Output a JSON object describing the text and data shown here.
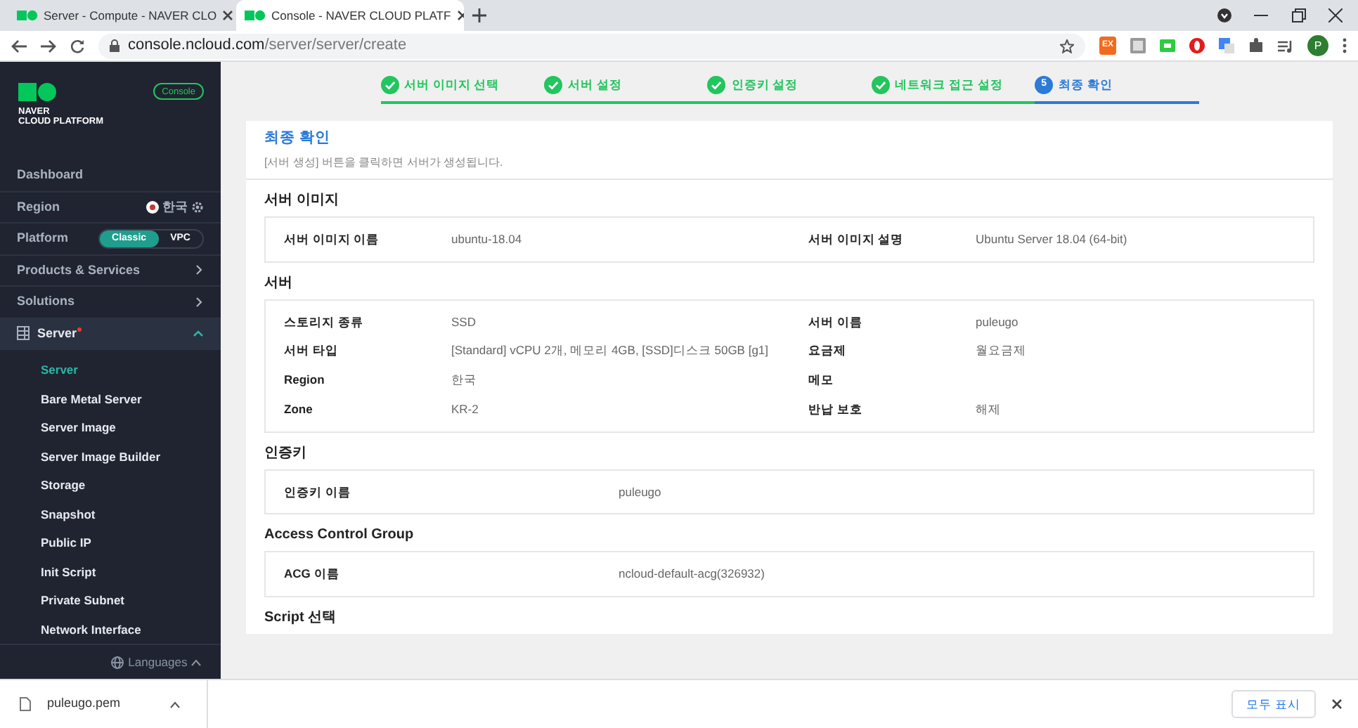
{
  "browser": {
    "tabs": [
      {
        "title": "Server - Compute - NAVER CLO",
        "selected": false
      },
      {
        "title": "Console - NAVER CLOUD PLATF",
        "selected": true
      }
    ],
    "url_host": "console.ncloud.com",
    "url_path": "/server/server/create",
    "extension_label": "EX",
    "profile_initial": "P"
  },
  "sidebar": {
    "logo_line1": "NAVER",
    "logo_line2": "CLOUD PLATFORM",
    "console_badge": "Console",
    "items": [
      {
        "kind": "link",
        "label": "Dashboard"
      },
      {
        "kind": "region",
        "label": "Region",
        "value": "한국"
      },
      {
        "kind": "toggle",
        "label": "Platform",
        "options": [
          {
            "label": "Classic",
            "selected": true
          },
          {
            "label": "VPC",
            "selected": false
          }
        ]
      },
      {
        "kind": "menu",
        "label": "Products & Services"
      },
      {
        "kind": "menu",
        "label": "Solutions"
      },
      {
        "kind": "group",
        "label": "Server",
        "expanded": true,
        "notice": true,
        "children": [
          {
            "label": "Server",
            "selected": true
          },
          {
            "label": "Bare Metal Server",
            "selected": false
          },
          {
            "label": "Server Image",
            "selected": false
          },
          {
            "label": "Server Image Builder",
            "selected": false
          },
          {
            "label": "Storage",
            "selected": false
          },
          {
            "label": "Snapshot",
            "selected": false
          },
          {
            "label": "Public IP",
            "selected": false
          },
          {
            "label": "Init Script",
            "selected": false
          },
          {
            "label": "Private Subnet",
            "selected": false
          },
          {
            "label": "Network Interface",
            "selected": false
          }
        ]
      }
    ],
    "languages": "Languages"
  },
  "steps": [
    {
      "label": "서버 이미지 선택",
      "done": true
    },
    {
      "label": "서버 설정",
      "done": true
    },
    {
      "label": "인증키 설정",
      "done": true
    },
    {
      "label": "네트워크 접근 설정",
      "done": true
    },
    {
      "label": "최종 확인",
      "done": false,
      "number": "5"
    }
  ],
  "card": {
    "title": "최종 확인",
    "subtitle": "[서버 생성] 버튼을 클릭하면 서버가 생성됩니다.",
    "sections": [
      {
        "title": "서버 이미지",
        "kind": "pairs",
        "fields": [
          {
            "label": "서버 이미지 이름",
            "value": "ubuntu-18.04"
          },
          {
            "label": "서버 이미지 설명",
            "value": "Ubuntu Server 18.04 (64-bit)"
          }
        ]
      },
      {
        "title": "서버",
        "kind": "pairs",
        "fields": [
          {
            "label": "스토리지 종류",
            "value": "SSD"
          },
          {
            "label": "서버 이름",
            "value": "puleugo"
          },
          {
            "label": "서버 타입",
            "value": "[Standard] vCPU 2개, 메모리 4GB, [SSD]디스크 50GB [g1]"
          },
          {
            "label": "요금제",
            "value": "월요금제"
          },
          {
            "label": "Region",
            "value": "한국"
          },
          {
            "label": "메모"
          },
          {
            "label": "Zone",
            "value": "KR-2"
          },
          {
            "label": "반납 보호",
            "value": "해제"
          }
        ]
      },
      {
        "title": "인증키",
        "kind": "single",
        "fields": [
          {
            "label": "인증키 이름",
            "value": "puleugo"
          }
        ]
      },
      {
        "title": "Access Control Group",
        "kind": "single",
        "fields": [
          {
            "label": "ACG 이름",
            "value": "ncloud-default-acg(326932)"
          }
        ]
      },
      {
        "title": "Script 선택"
      }
    ]
  },
  "downloads": {
    "file": "puleugo.pem",
    "show_all": "모두 표시"
  }
}
